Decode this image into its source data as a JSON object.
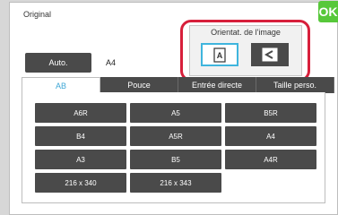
{
  "header": {
    "title": "Original",
    "ok_label": "OK"
  },
  "auto_label": "Auto.",
  "current_size": "A4",
  "orientation": {
    "label": "Orientat. de l'image",
    "portrait_glyph": "A",
    "landscape_glyph": "<"
  },
  "tabs": [
    {
      "label": "AB"
    },
    {
      "label": "Pouce"
    },
    {
      "label": "Entrée directe"
    },
    {
      "label": "Taille perso."
    }
  ],
  "sizes": [
    "A6R",
    "A5",
    "B5R",
    "B4",
    "A5R",
    "A4",
    "A3",
    "B5",
    "A4R",
    "216 x 340",
    "216 x 343"
  ],
  "colors": {
    "ok": "#57c83a",
    "highlight": "#d71f3b",
    "selected_border": "#3fb5dd",
    "button": "#4a4a4a"
  }
}
